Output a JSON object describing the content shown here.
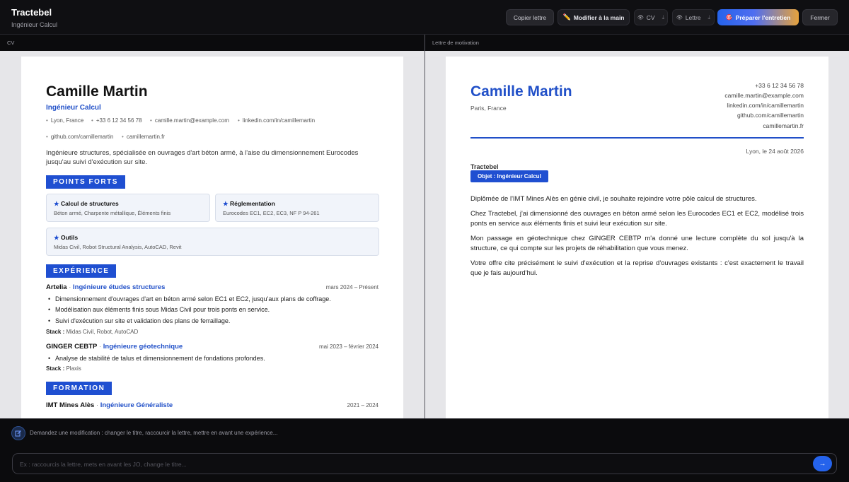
{
  "header": {
    "title": "Tractebel",
    "subtitle": "Ingénieur Calcul",
    "buttons": {
      "copy_letter": "Copier lettre",
      "edit_manual": "Modifier à la main",
      "cv": "CV",
      "letter": "Lettre",
      "prepare_interview": "Préparer l'entretien",
      "close": "Fermer"
    }
  },
  "panels": {
    "cv_label": "CV",
    "letter_label": "Lettre de motivation"
  },
  "cv": {
    "name": "Camille Martin",
    "role": "Ingénieur Calcul",
    "contacts": {
      "city": "Lyon, France",
      "phone": "+33 6 12 34 56 78",
      "email": "camille.martin@example.com",
      "linkedin": "linkedin.com/in/camillemartin",
      "github": "github.com/camillemartin",
      "site": "camillemartin.fr"
    },
    "summary": "Ingénieure structures, spécialisée en ouvrages d'art béton armé, à l'aise du dimensionnement Eurocodes jusqu'au suivi d'exécution sur site.",
    "sections": {
      "strengths": "POINTS FORTS",
      "experience": "EXPÉRIENCE",
      "education": "FORMATION"
    },
    "skills": [
      {
        "title": "Calcul de structures",
        "desc": "Béton armé, Charpente métallique, Éléments finis"
      },
      {
        "title": "Réglementation",
        "desc": "Eurocodes EC1, EC2, EC3, NF P 94-261"
      },
      {
        "title": "Outils",
        "desc": "Midas Civil, Robot Structural Analysis, AutoCAD, Revit"
      }
    ],
    "jobs": [
      {
        "company": "Artelia",
        "role": "Ingénieure études structures",
        "date": "mars 2024 – Présent",
        "bullets": [
          "Dimensionnement d'ouvrages d'art en béton armé selon EC1 et EC2, jusqu'aux plans de coffrage.",
          "Modélisation aux éléments finis sous Midas Civil pour trois ponts en service.",
          "Suivi d'exécution sur site et validation des plans de ferraillage."
        ],
        "stack_label": "Stack :",
        "stack": "Midas Civil, Robot, AutoCAD"
      },
      {
        "company": "GINGER CEBTP",
        "role": "Ingénieure géotechnique",
        "date": "mai 2023 – février 2024",
        "bullets": [
          "Analyse de stabilité de talus et dimensionnement de fondations profondes."
        ],
        "stack_label": "Stack :",
        "stack": "Plaxis"
      }
    ],
    "education": [
      {
        "school": "IMT Mines Alès",
        "degree": "Ingénieure Généraliste",
        "date": "2021 – 2024"
      }
    ],
    "separator": " · "
  },
  "letter": {
    "name": "Camille Martin",
    "city": "Paris, France",
    "contacts": [
      "+33 6 12 34 56 78",
      "camille.martin@example.com",
      "linkedin.com/in/camillemartin",
      "github.com/camillemartin",
      "camillemartin.fr"
    ],
    "date": "Lyon, le 24 août 2026",
    "company": "Tractebel",
    "object": "Objet : Ingénieur Calcul",
    "paragraphs": [
      "Diplômée de l'IMT Mines Alès en génie civil, je souhaite rejoindre votre pôle calcul de structures.",
      "Chez Tractebel, j'ai dimensionné des ouvrages en béton armé selon les Eurocodes EC1 et EC2, modélisé trois ponts en service aux éléments finis et suivi leur exécution sur site.",
      "Mon passage en géotechnique chez GINGER CEBTP m'a donné une lecture complète du sol jusqu'à la structure, ce qui compte sur les projets de réhabilitation que vous menez.",
      "Votre offre cite précisément le suivi d'exécution et la reprise d'ouvrages existants : c'est exactement le travail que je fais aujourd'hui."
    ]
  },
  "bottom": {
    "hint": "Demandez une modification : changer le titre, raccourcir la lettre, mettre en avant une expérience...",
    "placeholder": "Ex : raccourcis la lettre, mets en avant les JO, change le titre...",
    "send": "→"
  },
  "colors": {
    "accent": "#1f4fd1",
    "link": "#2150c8"
  }
}
